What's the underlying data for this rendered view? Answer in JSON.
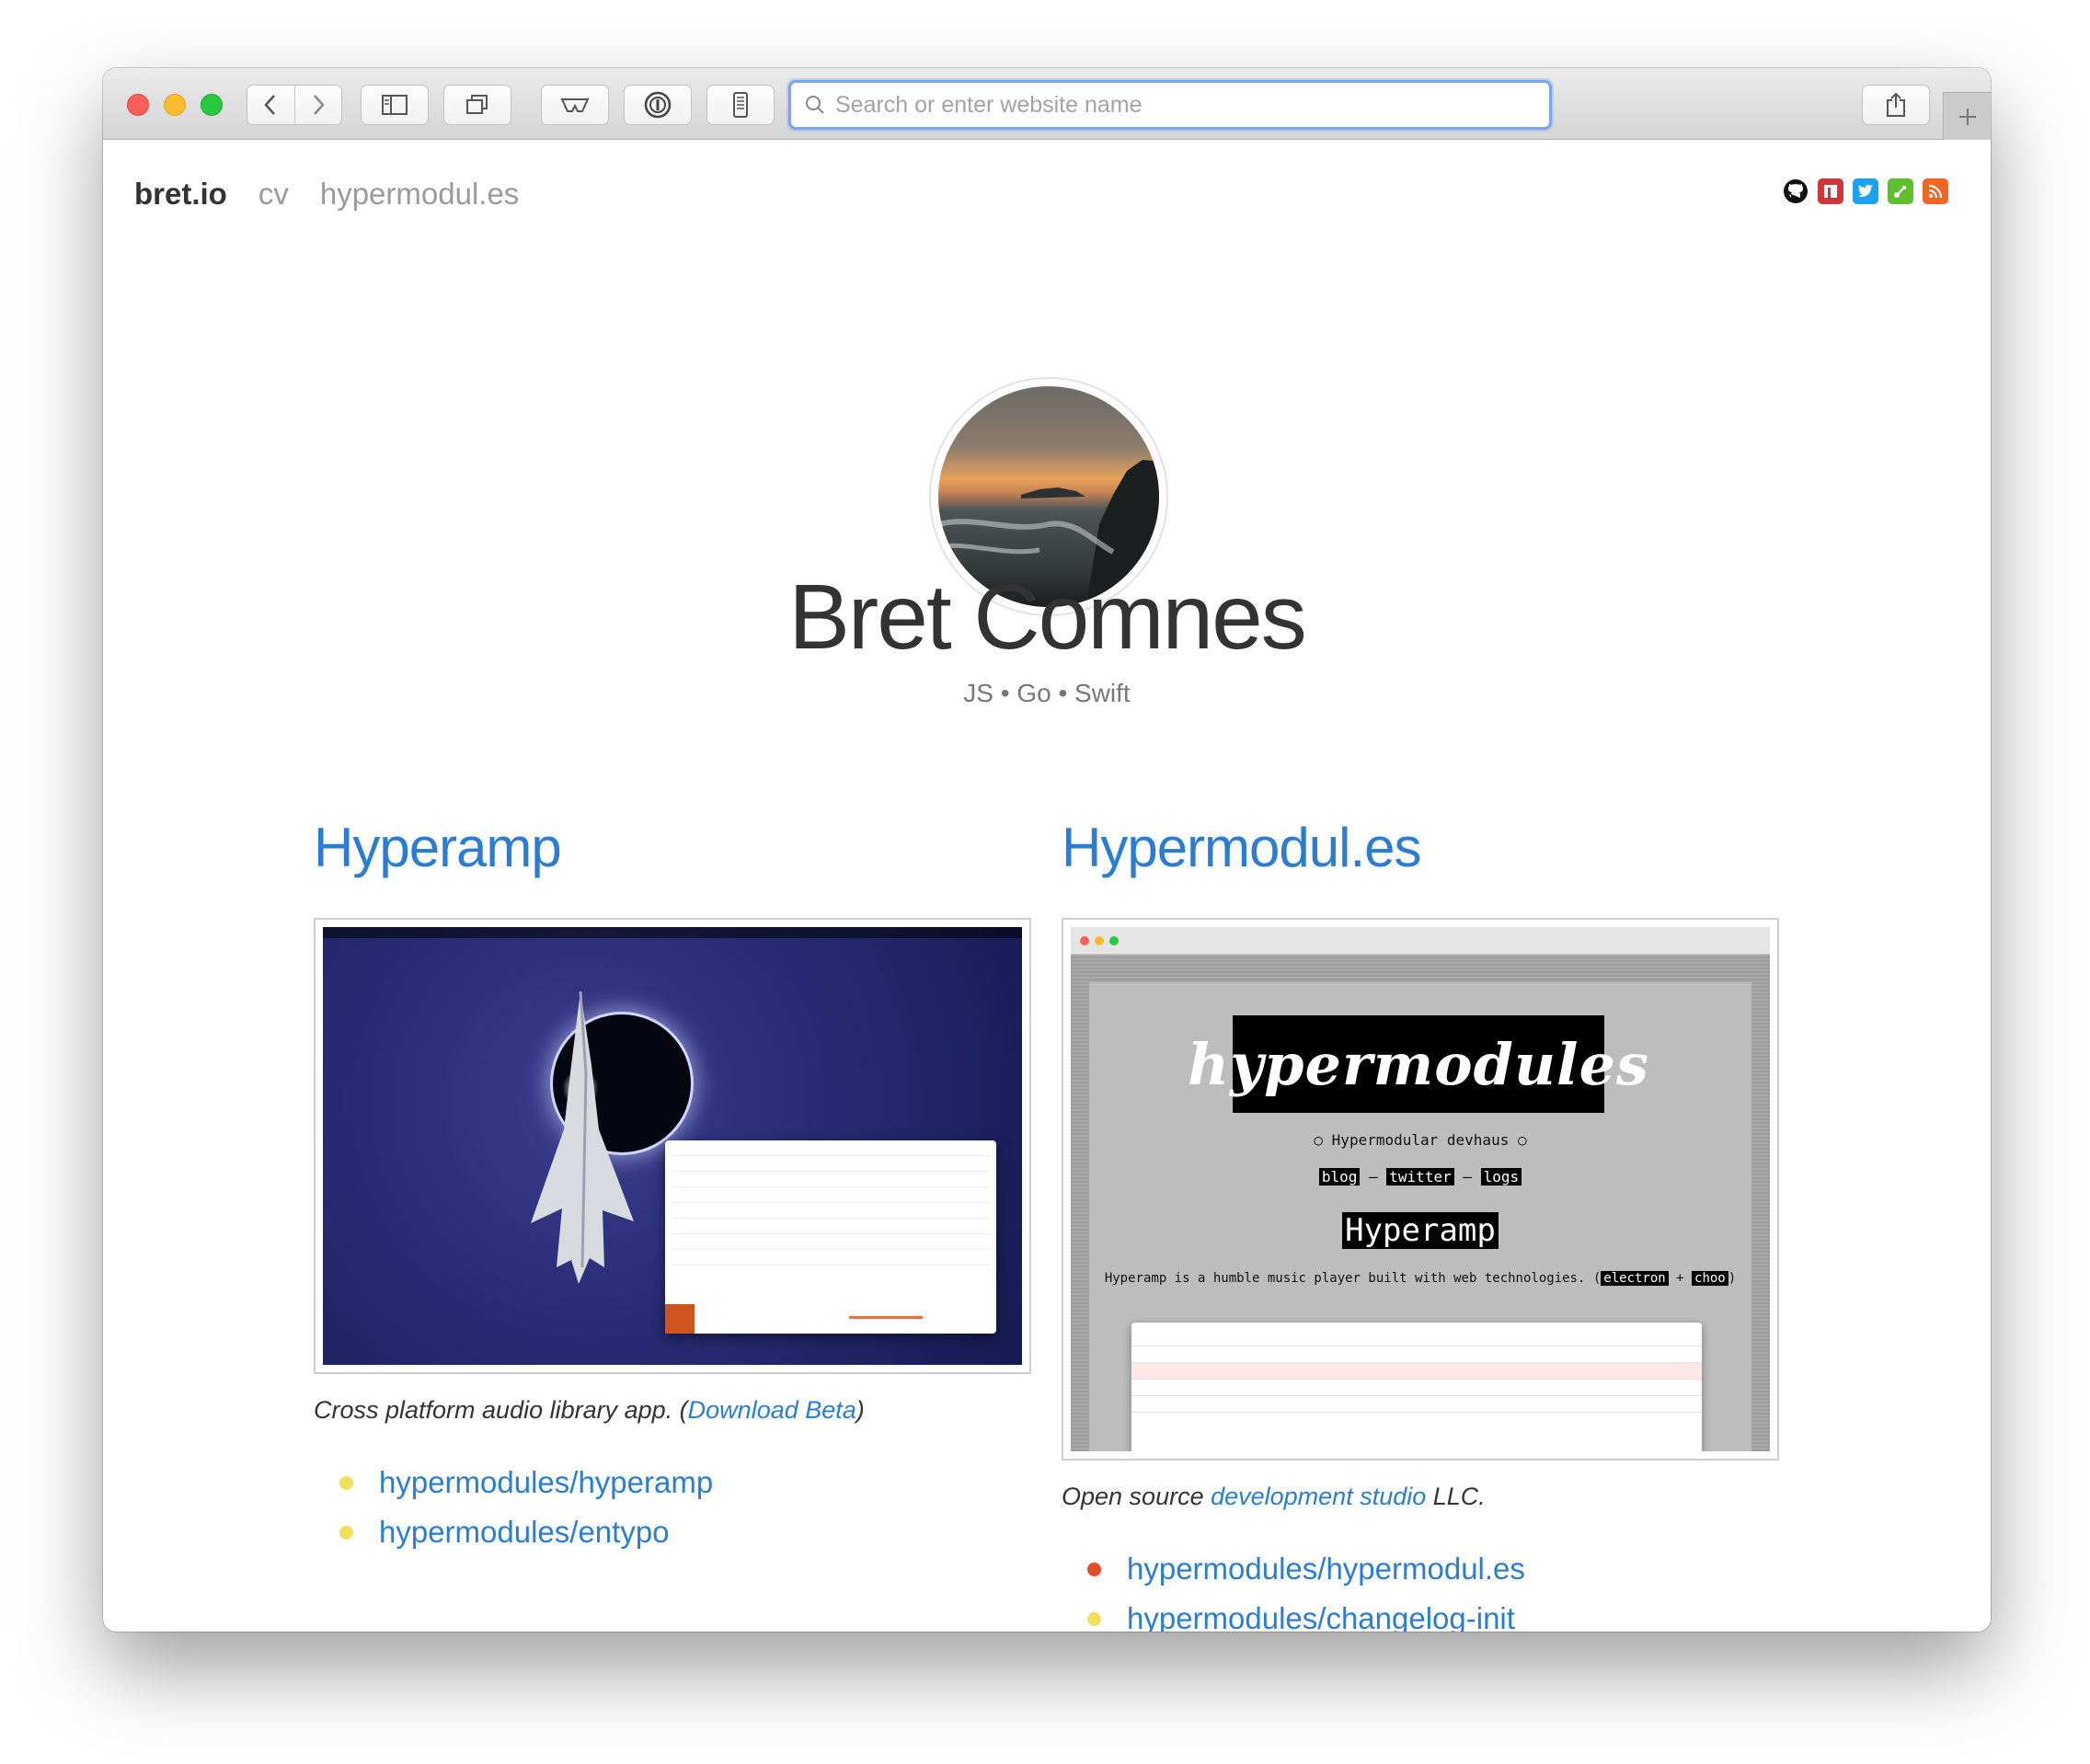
{
  "browser": {
    "address_placeholder": "Search or enter website name"
  },
  "site": {
    "brand": "bret.io",
    "nav": [
      "cv",
      "hypermodul.es"
    ],
    "social_icons": [
      "github-icon",
      "npm-icon",
      "twitter-icon",
      "keybase-icon",
      "rss-icon"
    ],
    "name": "Bret Comnes",
    "tagline": "JS • Go • Swift"
  },
  "projects": [
    {
      "title": "Hyperamp",
      "caption_prefix": "Cross platform audio library app. (",
      "caption_link": "Download Beta",
      "caption_suffix": ")",
      "repos": [
        {
          "name": "hypermodules/hyperamp",
          "dot_color": "#f1e05a"
        },
        {
          "name": "hypermodules/entypo",
          "dot_color": "#f1e05a"
        }
      ]
    },
    {
      "title": "Hypermodul.es",
      "caption_prefix": "Open source ",
      "caption_link": "development studio",
      "caption_suffix": " LLC.",
      "repos": [
        {
          "name": "hypermodules/hypermodul.es",
          "dot_color": "#e34c26"
        },
        {
          "name": "hypermodules/changelog-init",
          "dot_color": "#f1e05a"
        }
      ],
      "preview": {
        "logo": "hypermodules",
        "subtitle": "○ Hypermodular devhaus ○",
        "links": [
          "blog",
          "twitter",
          "logs"
        ],
        "heading": "Hyperamp",
        "blurb": "Hyperamp is a humble music player built with web technologies.",
        "tags": [
          "electron",
          "choo"
        ]
      }
    }
  ],
  "colors": {
    "link": "#2b7cd3",
    "focus_ring": "#7ba6ef"
  }
}
